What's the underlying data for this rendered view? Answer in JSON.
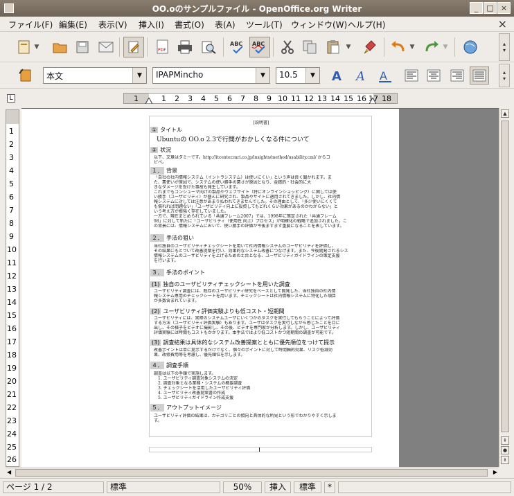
{
  "window": {
    "title": "OO.oのサンプルファイル - OpenOffice.org Writer"
  },
  "menu": {
    "items": [
      "ファイル(F)",
      "編集(E)",
      "表示(V)",
      "挿入(I)",
      "書式(O)",
      "表(A)",
      "ツール(T)",
      "ウィンドウ(W)",
      "ヘルプ(H)"
    ]
  },
  "format": {
    "paragraph_style": "本文",
    "font_name": "IPAPMincho",
    "font_size": "10.5"
  },
  "ruler": {
    "h_numbers": [
      "1",
      "1",
      "2",
      "3",
      "4",
      "5",
      "6",
      "7",
      "8",
      "9",
      "10",
      "11",
      "12",
      "13",
      "14",
      "15",
      "16",
      "17",
      "18"
    ],
    "v_numbers": [
      "1",
      "2",
      "3",
      "4",
      "5",
      "6",
      "7",
      "8",
      "9",
      "10",
      "11",
      "12",
      "13",
      "14",
      "15",
      "16",
      "17",
      "18",
      "19",
      "20",
      "21",
      "22",
      "23",
      "24",
      "25",
      "26"
    ]
  },
  "document": {
    "header_label": "[説明書]",
    "sec1_num": "①",
    "sec1_title": "タイトル",
    "doc_title": "Ubuntuの OO.o 2.3で行間がおかしくなる件について",
    "sec2_num": "②",
    "sec2_title": "状況",
    "sec2_line1": "以下、文章はダミーです。http://itcenter.mri.co.jp/insights/method/usability.cml/ からコ",
    "sec2_line2": "ピペ。",
    "h1_num": "１．",
    "h1_title": "背景",
    "p1": [
      "「自社の社内情報システム（イントラシステム）は使いにくい」という声は良く聞かれます。ま",
      "た、悪使いが原因で、システムの使い勝手の悪さが原因となり、金銭的・社会的に大",
      "きなダメージを受けた事故も発生しています。",
      "これまでもコンシューマ向けの製品やウェブサイト（特にオンラインショッピング）に関しては使",
      "い勝手（ユーザビリティ）が盛んに研究され、製品やサイトに適用されてきました。しかし、社内情",
      "報システムに対しては注意があまり払われてきませんでした。その理由として、「多少使いにくくて",
      "も慣れれば問題ない」「ユーザビリティ向上に投資してもどれくらい効果があるのかわからない」と",
      "いう考え方が根強く存在していました。",
      "一方で、現在まとめられている「共通フレーム2007」では、1998年に策定された「共通フレーム",
      "98」に対して新たに「ユーザビリティ（使用性 向上）プロセス」が明確化の戦略で追加されました。こ",
      "の背景には、情報システムにおいて、使い勝手の評価が今後ますます重要になることを表しています。"
    ],
    "h2_num": "２．",
    "h2_title": "手法の狙い",
    "p2": [
      "当社独自のユーザビリティチェックシートを用いて社内情報システムのユーザビリティを評価し、",
      "その結果にもとづいて改善提案を行い、効果的なシステム改善につなげます。また、今後開発されるシス",
      "情報システムのユーザビリティを上げるための土台となる、ユーザビリティガイドラインの策定支援",
      "を行います。"
    ],
    "h3_num": "３．",
    "h3_title": "手法のポイント",
    "sub1_num": "(1)",
    "sub1_title": "独自のユーザビリティチェックシートを用いた調査",
    "p3": [
      "ユーザビリティ調査には、既存のユーザビリティ研究をベースとして開発した、当社独自の社内情",
      "報システム専用のチェックシートを用います。チェックシートは社内情報システムに特化した項目",
      "が多数含まれています。"
    ],
    "sub2_num": "(2)",
    "sub2_title": "ユーザビリティ評価実験よりも低コスト・短期間",
    "p4": [
      "ユーザビリティには、実際のシステムユーザにいくつかのタスクを実行してもらうことによって評価",
      "する方法（ユーザビリティ評価実験）もあります。ユーザはタスクを実行しながら感じたことを口に",
      "出し、その様子をビデオに撮影し、その後、ビデオを専門家が分析します。しかし、ユーザビリティ",
      "評価実験には時間もコストもかかります。本手法ではより低コストかつ短期間の調査が可能です。"
    ],
    "sub3_num": "(3)",
    "sub3_title": "調査結果は具体的なシステム改善提案とともに優先順位をつけて提示",
    "p5": [
      "改善ポイントは単に提示するだけでなく、個々のポイントに対して時間軸的効果、リスク低減効",
      "果、改修費用等を考慮し、優先順位を示します。"
    ],
    "h4_num": "４．",
    "h4_title": "調査手順",
    "p6_intro": "調査は以下の手順で実施します。",
    "steps": [
      "1. ユーザビリティ調査対象システムの決定",
      "2. 調査対象となる業務・システムの概要調査",
      "3. チェックシートを活用したユーザビリティ評価",
      "4. ユーザビリティ改善提案書の作成",
      "5. ユーザビリティガイドライン作成支援"
    ],
    "h5_num": "５．",
    "h5_title": "アウトプットイメージ",
    "p7": [
      "ユーザビリティ評価の結果は、カテゴリごとの傾向と具体的な所見という形でわかりやすく示しま",
      "す。"
    ]
  },
  "status": {
    "page": "ページ 1 / 2",
    "page_style": "標準",
    "zoom": "50%",
    "insert_mode": "挿入",
    "selection_mode": "標準",
    "modified": "*"
  }
}
